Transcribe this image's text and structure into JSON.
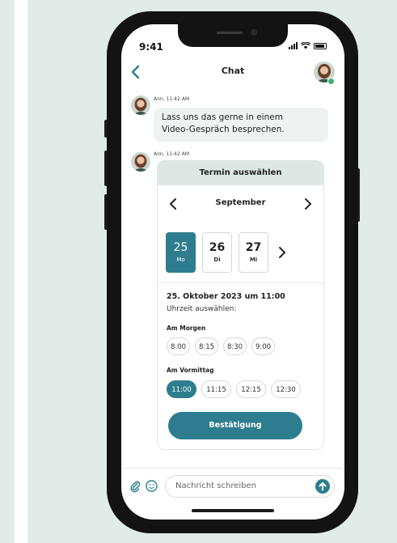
{
  "status_bar": {
    "time": "9:41"
  },
  "header": {
    "title": "Chat"
  },
  "messages": [
    {
      "meta": "Ann, 11:42 AM",
      "text_lines": [
        "Lass uns das gerne in einem",
        "Video-Gespräch besprechen."
      ]
    },
    {
      "meta": "Ann, 11:42 AM"
    }
  ],
  "scheduler": {
    "title": "Termin auswählen",
    "month": "September",
    "days": [
      {
        "num": "25",
        "weekday": "Mo",
        "selected": true
      },
      {
        "num": "26",
        "weekday": "Di",
        "selected": false
      },
      {
        "num": "27",
        "weekday": "Mi",
        "selected": false
      }
    ],
    "selected_date": "25. Oktober 2023 um 11:00",
    "choose_time": "Uhrzeit auswählen:",
    "sections": [
      {
        "label": "Am Morgen",
        "slots": [
          "8:00",
          "8:15",
          "8:30",
          "9:00"
        ],
        "selected": ""
      },
      {
        "label": "Am Vormittag",
        "slots": [
          "11:00",
          "11:15",
          "12:15",
          "12:30"
        ],
        "selected": "11:00"
      }
    ],
    "confirm_label": "Bestätigung"
  },
  "composer": {
    "placeholder": "Nachricht schreiben"
  },
  "colors": {
    "accent": "#2e7d8f",
    "background": "#e1ece9",
    "bubble": "#eef2f1",
    "card_header": "#dde8e5"
  }
}
